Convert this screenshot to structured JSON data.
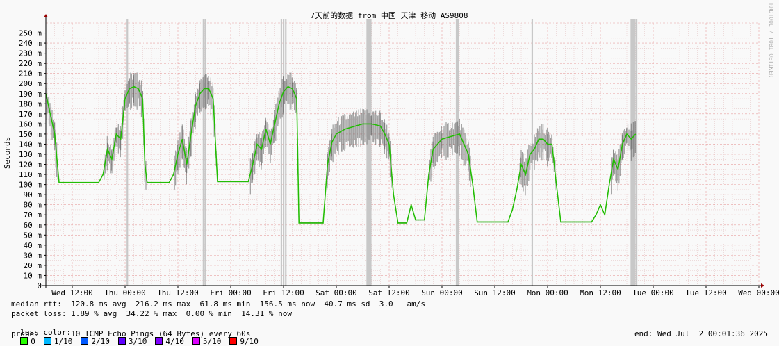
{
  "chart_data": {
    "type": "line",
    "title": "7天前的数据 from 中国 天津 移动 AS9808",
    "ylabel": "Seconds",
    "ylim": [
      0,
      0.26
    ],
    "y_ticks": [
      "0",
      "10 m",
      "20 m",
      "30 m",
      "40 m",
      "50 m",
      "60 m",
      "70 m",
      "80 m",
      "90 m",
      "100 m",
      "110 m",
      "120 m",
      "130 m",
      "140 m",
      "150 m",
      "160 m",
      "170 m",
      "180 m",
      "190 m",
      "200 m",
      "210 m",
      "220 m",
      "230 m",
      "240 m",
      "250 m"
    ],
    "x_ticks": [
      "Wed 12:00",
      "Thu 00:00",
      "Thu 12:00",
      "Fri 00:00",
      "Fri 12:00",
      "Sat 00:00",
      "Sat 12:00",
      "Sun 00:00",
      "Sun 12:00",
      "Mon 00:00",
      "Mon 12:00",
      "Tue 00:00",
      "Tue 12:00",
      "Wed 00:00"
    ],
    "x_hours_range": [
      -6,
      156
    ],
    "median_rtt_ms": [
      [
        -6,
        190
      ],
      [
        -4,
        150
      ],
      [
        -3,
        102
      ],
      [
        0,
        102
      ],
      [
        6,
        102
      ],
      [
        7,
        110
      ],
      [
        8,
        135
      ],
      [
        9,
        125
      ],
      [
        10,
        150
      ],
      [
        11,
        145
      ],
      [
        12,
        185
      ],
      [
        13,
        195
      ],
      [
        14,
        197
      ],
      [
        15,
        195
      ],
      [
        16,
        185
      ],
      [
        16.5,
        120
      ],
      [
        17,
        102
      ],
      [
        22,
        102
      ],
      [
        23,
        110
      ],
      [
        24,
        130
      ],
      [
        25,
        145
      ],
      [
        26,
        120
      ],
      [
        27,
        150
      ],
      [
        28,
        178
      ],
      [
        29,
        190
      ],
      [
        30,
        195
      ],
      [
        31,
        195
      ],
      [
        32,
        185
      ],
      [
        33,
        103
      ],
      [
        40,
        103
      ],
      [
        41,
        120
      ],
      [
        42,
        140
      ],
      [
        43,
        135
      ],
      [
        44,
        155
      ],
      [
        45,
        140
      ],
      [
        46,
        160
      ],
      [
        47,
        180
      ],
      [
        48,
        192
      ],
      [
        49,
        197
      ],
      [
        50,
        195
      ],
      [
        51,
        185
      ],
      [
        51.5,
        62
      ],
      [
        57,
        62
      ],
      [
        58,
        120
      ],
      [
        59,
        142
      ],
      [
        60,
        150
      ],
      [
        62,
        155
      ],
      [
        66,
        160
      ],
      [
        68,
        160
      ],
      [
        70,
        158
      ],
      [
        71,
        150
      ],
      [
        72,
        140
      ],
      [
        73,
        90
      ],
      [
        74,
        62
      ],
      [
        76,
        62
      ],
      [
        77,
        80
      ],
      [
        78,
        65
      ],
      [
        80,
        65
      ],
      [
        81,
        110
      ],
      [
        82,
        135
      ],
      [
        84,
        145
      ],
      [
        88,
        150
      ],
      [
        89,
        140
      ],
      [
        90,
        130
      ],
      [
        91,
        100
      ],
      [
        92,
        63
      ],
      [
        99,
        63
      ],
      [
        100,
        75
      ],
      [
        101,
        95
      ],
      [
        102,
        120
      ],
      [
        103,
        110
      ],
      [
        104,
        130
      ],
      [
        105,
        135
      ],
      [
        106,
        145
      ],
      [
        107,
        145
      ],
      [
        108,
        140
      ],
      [
        109,
        140
      ],
      [
        110,
        100
      ],
      [
        111,
        63
      ],
      [
        118,
        63
      ],
      [
        119,
        70
      ],
      [
        120,
        80
      ],
      [
        121,
        70
      ],
      [
        122,
        100
      ],
      [
        123,
        125
      ],
      [
        124,
        115
      ],
      [
        125,
        140
      ],
      [
        126,
        150
      ],
      [
        127,
        145
      ],
      [
        128,
        150
      ]
    ],
    "loss_spikes_hours": [
      12.5,
      29.8,
      30.2,
      47.5,
      48,
      48.5,
      67,
      67.4,
      67.8,
      87.3,
      87.6,
      104.5,
      127,
      127.4,
      127.8,
      128.2
    ],
    "series": []
  },
  "stats": {
    "median_rtt": "median rtt:  120.8 ms avg  216.2 ms max  61.8 ms min  156.5 ms now  40.7 ms sd  3.0   am/s",
    "packet_loss": "packet loss: 1.89 % avg  34.22 % max  0.00 % min  14.31 % now",
    "loss_color_label": "loss color:",
    "loss_colors": [
      {
        "label": "0",
        "color": "#26ff00"
      },
      {
        "label": "1/10",
        "color": "#00b8ff"
      },
      {
        "label": "2/10",
        "color": "#0059ff"
      },
      {
        "label": "3/10",
        "color": "#5e00ff"
      },
      {
        "label": "4/10",
        "color": "#7e00ff"
      },
      {
        "label": "5/10",
        "color": "#dd00ff"
      },
      {
        "label": "9/10",
        "color": "#ff0000"
      }
    ],
    "probe": "probe:       10 ICMP Echo Pings (64 Bytes) every 60s",
    "end": "end: Wed Jul  2 00:01:36 2025"
  },
  "watermark": "RRDTOOL / TOBI OETIKER",
  "colors": {
    "grid_major": "#e8a0a0",
    "grid_minor": "#e6c8c8",
    "loss": "#c8c8c8",
    "smoke": "#555555",
    "median": "#22cc00"
  }
}
